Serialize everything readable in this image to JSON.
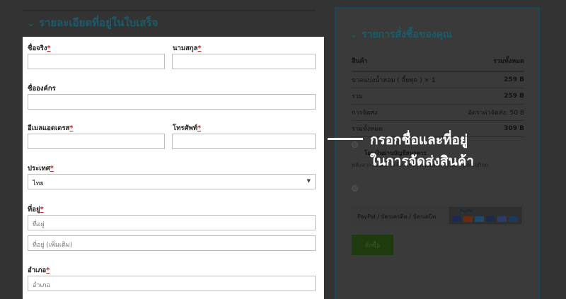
{
  "background": {
    "billing_title": "รายละเอียดที่อยู่ในใบเสร็จ",
    "order_title": "รายการสั่งซื้อของคุณ",
    "order_table": {
      "col_product": "สินค้า",
      "col_total": "รวมทั้งหมด",
      "rows": [
        {
          "label": "ขวดแบ่งน้ำหอม ( ลี้ยทุด ) × 1",
          "value": "259 B",
          "light": false
        },
        {
          "label": "รวม",
          "value": "259 B",
          "light": false
        },
        {
          "label": "การจัดส่ง",
          "value": "อัตราค่าจัดส่ง: 50 B",
          "light": true
        },
        {
          "label": "รวมทั้งหมด",
          "value": "309 B",
          "light": false
        }
      ]
    },
    "payment_option_1": "โอนเงินผ่านบัญชีธนาคาร",
    "payment_option_1_desc": "หลังจากโอนแล้วแจ้งการชำระเงินทาง LINE : portofino",
    "payment_option_2": "PayPal / บัตรเครดิต / บัตรเดบิต",
    "paypal_logo": "PayPal",
    "order_button": "สั่งซื้อ"
  },
  "form": {
    "first_name_label": "ชื่อจริง",
    "last_name_label": "นามสกุล",
    "company_label": "ชื่อองค์กร",
    "email_label": "อีเมลแอดเดรส",
    "phone_label": "โทรศัพท์",
    "country_label": "ประเทศ",
    "country_value": "ไทย",
    "address_label": "ที่อยู่",
    "address_placeholder": "ที่อยู่",
    "address2_placeholder": "ที่อยู่ (เพิ่มเติม)",
    "district_label": "อำเภอ",
    "district_placeholder": "อำเภอ",
    "required_mark": "*"
  },
  "callout": {
    "line1": "กรอกชื่อและที่อยู่",
    "line2": "ในการจัดส่งสินค้า"
  },
  "icons": {
    "section_chevron": "chevron-down-icon",
    "select_caret": "caret-down-icon"
  },
  "colors": {
    "backdrop": "#333333",
    "form_panel": "#ffffff",
    "accent_dim": "#1b5b6a",
    "required": "#b22222",
    "callout_text": "#ffffff"
  }
}
